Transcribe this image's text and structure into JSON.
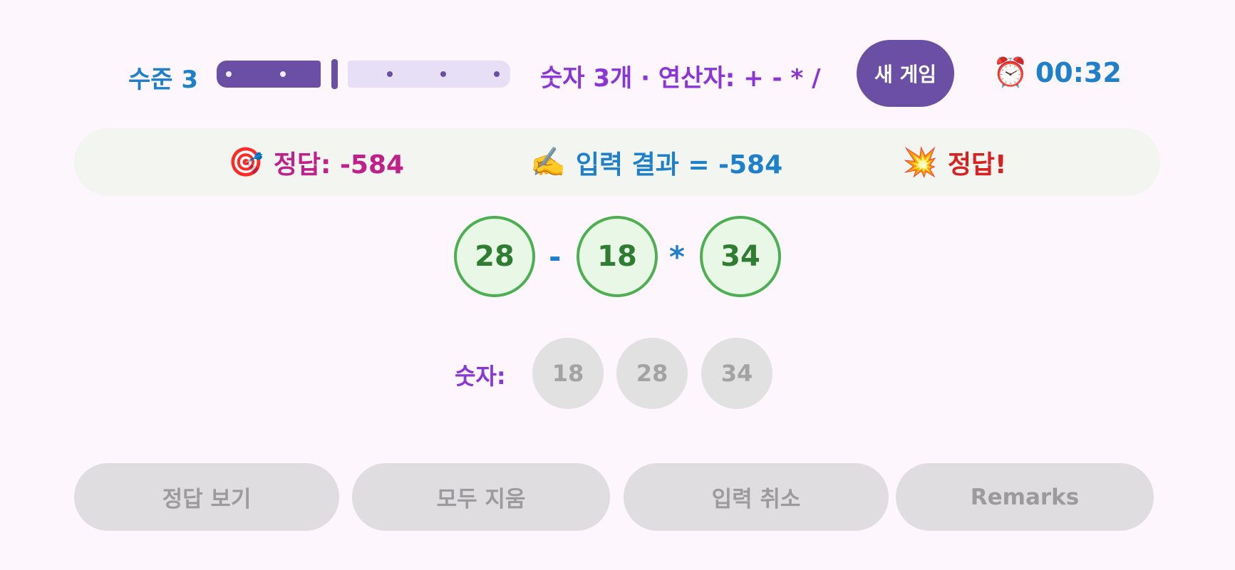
{
  "header": {
    "level_label": "수준 3",
    "level_value": 3,
    "level_max": 6,
    "rule_text": "숫자 3개 · 연산자: + - * /",
    "new_game_label": "새 게임",
    "timer_icon": "alarm-clock-icon",
    "timer_emoji": "⏰",
    "timer_value": "00:32"
  },
  "status": {
    "target_emoji": "🎯",
    "target_text": "정답: -584",
    "input_emoji": "✍️",
    "input_text": "입력 결과 = -584",
    "verdict_emoji": "💥",
    "verdict_text": "정답!"
  },
  "expression": {
    "operands": [
      "28",
      "18",
      "34"
    ],
    "operators": [
      "-",
      "*"
    ]
  },
  "numbers": {
    "label": "숫자:",
    "chips": [
      "18",
      "28",
      "34"
    ]
  },
  "buttons": {
    "show_answer": "정답 보기",
    "clear_all": "모두 지움",
    "undo_input": "입력 취소",
    "remarks": "Remarks"
  },
  "colors": {
    "accent_purple": "#6a4fa5",
    "blue_text": "#1e7fcb",
    "purple_text": "#8a35d6",
    "magenta_text": "#c0208a",
    "red_text": "#d92121",
    "green_border": "#4caf50"
  }
}
